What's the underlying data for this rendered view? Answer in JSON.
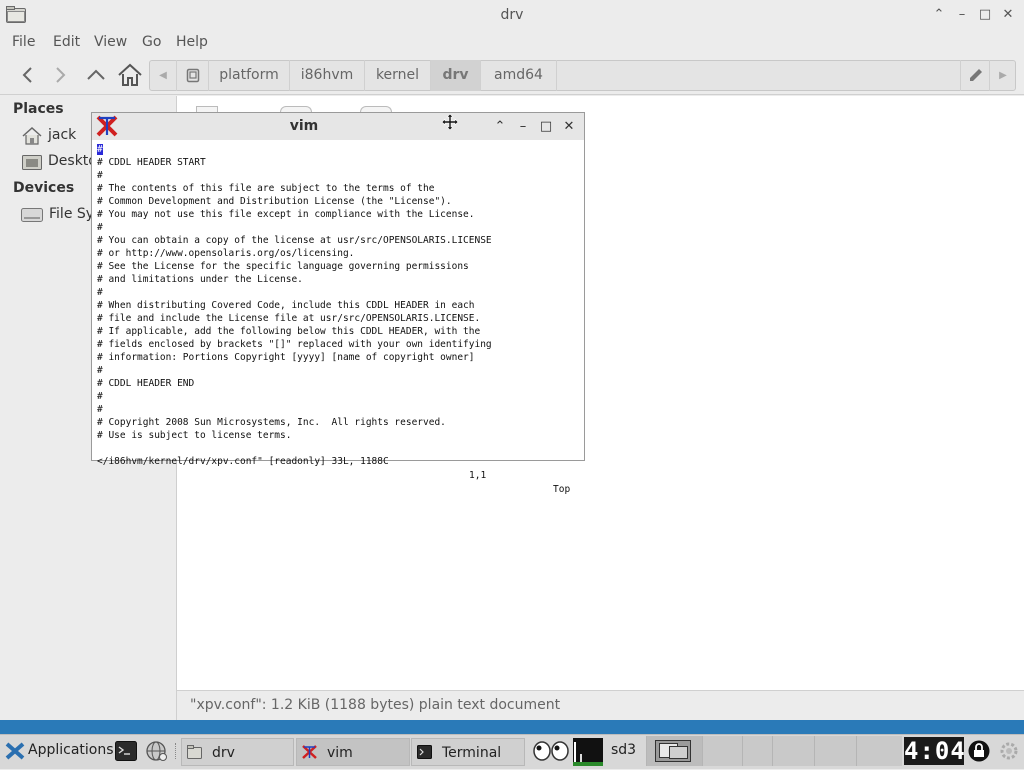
{
  "file_manager": {
    "title": "drv",
    "menus": [
      "File",
      "Edit",
      "View",
      "Go",
      "Help"
    ],
    "breadcrumbs": [
      "platform",
      "i86hvm",
      "kernel",
      "drv",
      "amd64"
    ],
    "active_crumb": "drv",
    "sidebar": {
      "places_heading": "Places",
      "places": [
        {
          "label": "jack",
          "icon": "home-icon"
        },
        {
          "label": "Deskto",
          "icon": "desktop-folder-icon"
        }
      ],
      "devices_heading": "Devices",
      "devices": [
        {
          "label": "File Sy",
          "icon": "drive-icon"
        }
      ]
    },
    "status": "\"xpv.conf\": 1.2 KiB (1188 bytes) plain text document"
  },
  "vim": {
    "title": "vim",
    "cursor_char": "#",
    "lines": [
      "# CDDL HEADER START",
      "#",
      "# The contents of this file are subject to the terms of the",
      "# Common Development and Distribution License (the \"License\").",
      "# You may not use this file except in compliance with the License.",
      "#",
      "# You can obtain a copy of the license at usr/src/OPENSOLARIS.LICENSE",
      "# or http://www.opensolaris.org/os/licensing.",
      "# See the License for the specific language governing permissions",
      "# and limitations under the License.",
      "#",
      "# When distributing Covered Code, include this CDDL HEADER in each",
      "# file and include the License file at usr/src/OPENSOLARIS.LICENSE.",
      "# If applicable, add the following below this CDDL HEADER, with the",
      "# fields enclosed by brackets \"[]\" replaced with your own identifying",
      "# information: Portions Copyright [yyyy] [name of copyright owner]",
      "#",
      "# CDDL HEADER END",
      "#",
      "#",
      "# Copyright 2008 Sun Microsystems, Inc.  All rights reserved.",
      "# Use is subject to license terms."
    ],
    "status_file": "</i86hvm/kernel/drv/xpv.conf\" [readonly] 33L, 1188C",
    "status_pos": "1,1",
    "status_scroll": "Top"
  },
  "taskbar": {
    "applications_label": "Applications",
    "tasks": [
      {
        "label": "drv",
        "icon": "folder-icon"
      },
      {
        "label": "vim",
        "icon": "xterm-icon"
      },
      {
        "label": "Terminal",
        "icon": "terminal-icon"
      }
    ],
    "workspace_label": "sd3",
    "clock": "4:04"
  },
  "colors": {
    "panel_accent": "#2a7ab8",
    "vim_cursor": "#2a2ad8",
    "xterm_icon_red": "#d02020",
    "xterm_icon_blue": "#2040c0"
  }
}
